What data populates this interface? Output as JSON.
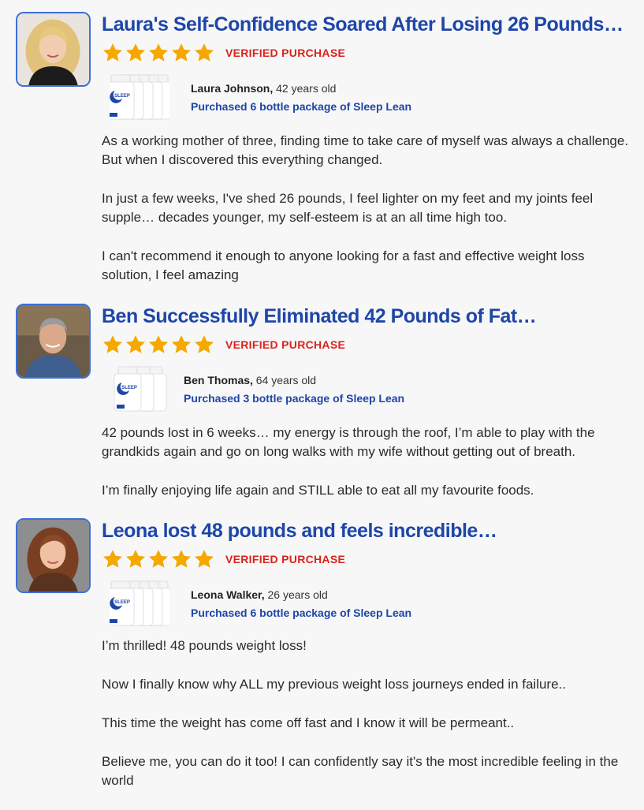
{
  "reviews": [
    {
      "title": "Laura's Self-Confidence Soared After Losing 26 Pounds…",
      "rating": 5,
      "verified": "VERIFIED PURCHASE",
      "buyer_name": "Laura Johnson,",
      "buyer_age": " 42 years old",
      "purchase": "Purchased 6 bottle package of Sleep Lean",
      "bottles": 6,
      "paragraphs": [
        "As a working mother of three, finding time to take care of myself was always a challenge. But when I discovered this everything changed.",
        "In just a few weeks, I've shed 26 pounds, I feel lighter on my feet and my joints feel supple… decades younger, my self-esteem is at an all time high too.",
        "I can't recommend it enough to anyone looking for a fast and effective weight loss solution, I feel amazing"
      ]
    },
    {
      "title": "Ben Successfully Eliminated 42 Pounds of Fat…",
      "rating": 5,
      "verified": "VERIFIED PURCHASE",
      "buyer_name": "Ben Thomas,",
      "buyer_age": " 64 years old",
      "purchase": "Purchased 3 bottle package of Sleep Lean",
      "bottles": 3,
      "paragraphs": [
        "42 pounds lost in 6 weeks… my energy is through the roof, I’m able to play with the grandkids again and go on long walks with my wife without getting out of breath.",
        "I’m finally enjoying life again and STILL able to eat all my favourite foods."
      ]
    },
    {
      "title": "Leona lost 48 pounds and feels incredible…",
      "rating": 5,
      "verified": "VERIFIED PURCHASE",
      "buyer_name": "Leona Walker,",
      "buyer_age": " 26 years old",
      "purchase": "Purchased 6 bottle package of Sleep Lean",
      "bottles": 6,
      "paragraphs": [
        "I’m thrilled! 48 pounds weight loss!",
        "Now I finally know why ALL my previous weight loss journeys ended in failure..",
        "This time the weight has come off fast and I know it will be permeant..",
        "Believe me, you can do it too! I can confidently say it's the most incredible feeling in the world"
      ]
    }
  ],
  "product_label": "SLEEP LEAN",
  "colors": {
    "title": "#1e46a8",
    "verified": "#d8231c",
    "star": "#f5a800",
    "avatar_border": "#3b6fd6"
  },
  "icons": {
    "star": "star-icon",
    "product": "sleep-lean-bottle-icon"
  }
}
